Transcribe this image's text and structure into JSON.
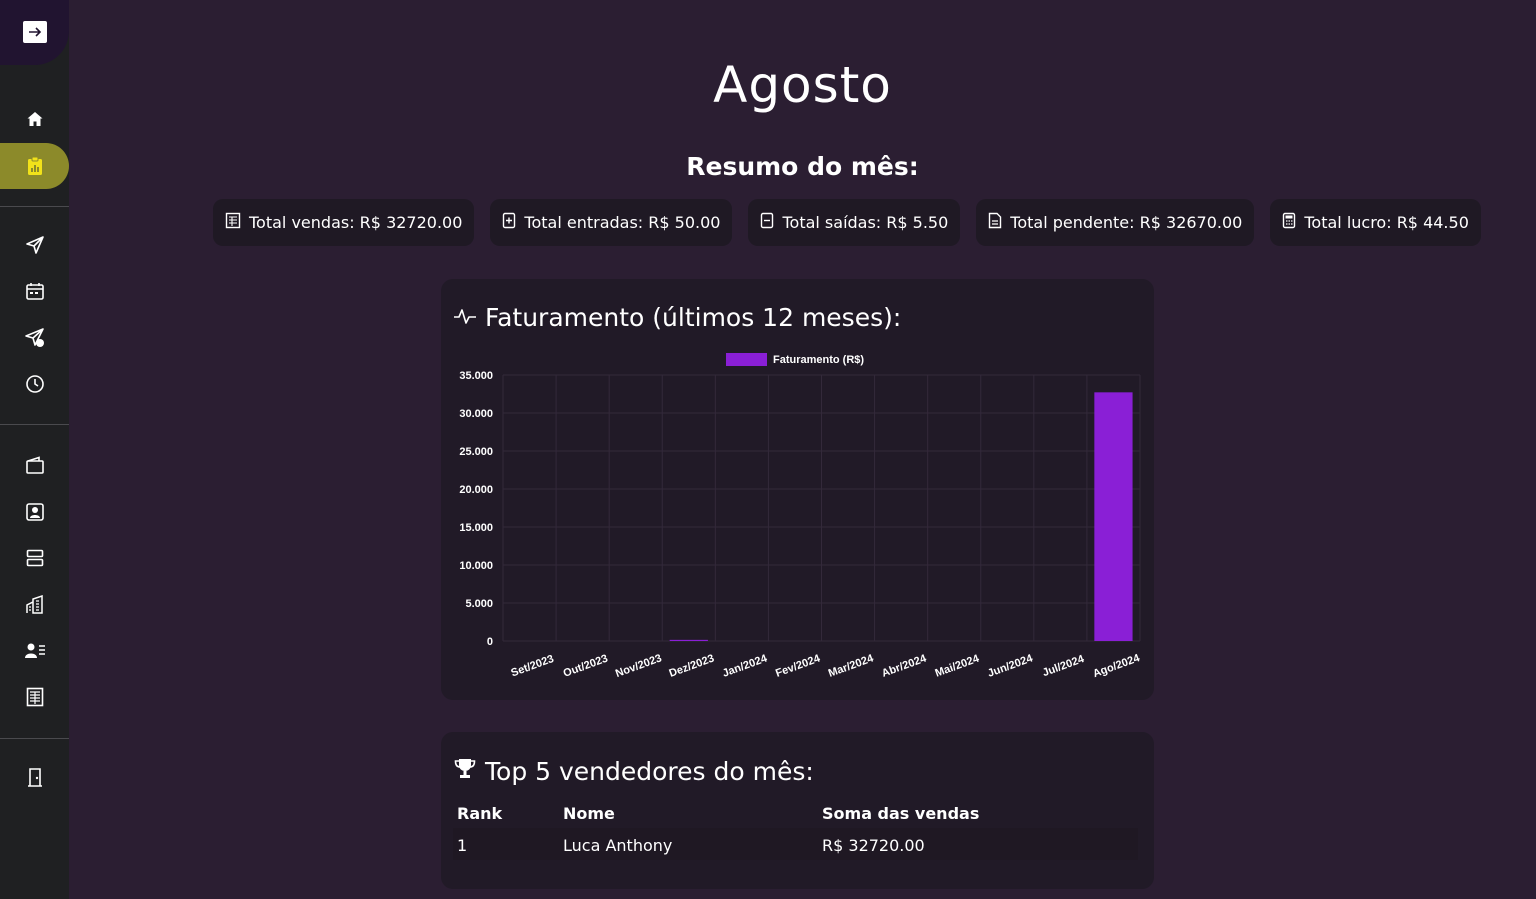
{
  "page": {
    "title": "Agosto",
    "subtitle": "Resumo do mês:"
  },
  "summary_cards": [
    {
      "label": "Total vendas: R$ 32720.00",
      "icon": "receipt-icon"
    },
    {
      "label": "Total entradas: R$ 50.00",
      "icon": "file-plus-icon"
    },
    {
      "label": "Total saídas: R$ 5.50",
      "icon": "file-minus-icon"
    },
    {
      "label": "Total pendente: R$ 32670.00",
      "icon": "file-text-icon"
    },
    {
      "label": "Total lucro: R$ 44.50",
      "icon": "calculator-icon"
    }
  ],
  "sidebar": {
    "items": [
      {
        "name": "home",
        "icon": "home-icon"
      },
      {
        "name": "reports",
        "icon": "clipboard-chart-icon",
        "active": true
      },
      {
        "name": "send",
        "icon": "send-icon"
      },
      {
        "name": "calendar",
        "icon": "calendar-icon"
      },
      {
        "name": "send-alert",
        "icon": "send-badge-icon"
      },
      {
        "name": "history",
        "icon": "clock-icon"
      },
      {
        "name": "wallet",
        "icon": "wallet-icon"
      },
      {
        "name": "contacts",
        "icon": "user-card-icon"
      },
      {
        "name": "servers",
        "icon": "server-icon"
      },
      {
        "name": "buildings",
        "icon": "building-icon"
      },
      {
        "name": "users-list",
        "icon": "users-list-icon"
      },
      {
        "name": "ledger",
        "icon": "ledger-icon"
      },
      {
        "name": "exit",
        "icon": "door-icon"
      }
    ],
    "accent": "#8c8a2a"
  },
  "revenue_panel": {
    "title": "Faturamento (últimos 12 meses):"
  },
  "chart_data": {
    "type": "bar",
    "categories": [
      "Set/2023",
      "Out/2023",
      "Nov/2023",
      "Dez/2023",
      "Jan/2024",
      "Fev/2024",
      "Mar/2024",
      "Abr/2024",
      "Mai/2024",
      "Jun/2024",
      "Jul/2024",
      "Ago/2024"
    ],
    "series": [
      {
        "name": "Faturamento (R$)",
        "values": [
          0,
          0,
          0,
          150,
          0,
          0,
          0,
          0,
          0,
          0,
          0,
          32720
        ],
        "color": "#8a1fd6"
      }
    ],
    "yticks": [
      "35.000",
      "30.000",
      "25.000",
      "20.000",
      "15.000",
      "10.000",
      "5.000",
      "0"
    ],
    "ylim": [
      0,
      35000
    ],
    "legend_position": "top-center",
    "grid": true
  },
  "top_sellers": {
    "title": "Top 5 vendedores do mês:",
    "columns": [
      "Rank",
      "Nome",
      "Soma das vendas"
    ],
    "rows": [
      {
        "rank": "1",
        "name": "Luca Anthony",
        "total": "R$ 32720.00"
      }
    ]
  }
}
